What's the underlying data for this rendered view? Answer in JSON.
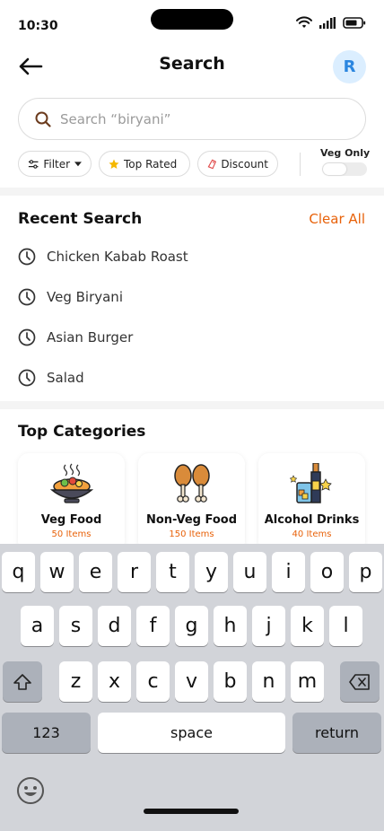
{
  "status_bar": {
    "time": "10:30"
  },
  "header": {
    "title": "Search",
    "avatar_initial": "R"
  },
  "search": {
    "placeholder": "Search “biryani”"
  },
  "filters": {
    "filter_label": "Filter",
    "top_rated_label": "Top Rated",
    "discount_label": "Discount",
    "veg_only_label": "Veg Only",
    "veg_only_enabled": false
  },
  "recent": {
    "title": "Recent Search",
    "clear_label": "Clear All",
    "items": [
      "Chicken Kabab Roast",
      "Veg Biryani",
      "Asian Burger",
      "Salad"
    ]
  },
  "categories": {
    "title": "Top Categories",
    "items": [
      {
        "name": "Veg Food",
        "count": "50 Items",
        "icon": "veg-food-icon"
      },
      {
        "name": "Non-Veg Food",
        "count": "150 Items",
        "icon": "chicken-leg-icon"
      },
      {
        "name": "Alcohol Drinks",
        "count": "40 Items",
        "icon": "drinks-icon"
      }
    ]
  },
  "keyboard": {
    "row1": [
      "q",
      "w",
      "e",
      "r",
      "t",
      "y",
      "u",
      "i",
      "o",
      "p"
    ],
    "row2": [
      "a",
      "s",
      "d",
      "f",
      "g",
      "h",
      "j",
      "k",
      "l"
    ],
    "row3": [
      "z",
      "x",
      "c",
      "v",
      "b",
      "n",
      "m"
    ],
    "numbers_label": "123",
    "space_label": "space",
    "return_label": "return"
  },
  "colors": {
    "accent": "#e8620a",
    "avatar_bg": "#dbeeff",
    "avatar_text": "#2b86e0"
  }
}
